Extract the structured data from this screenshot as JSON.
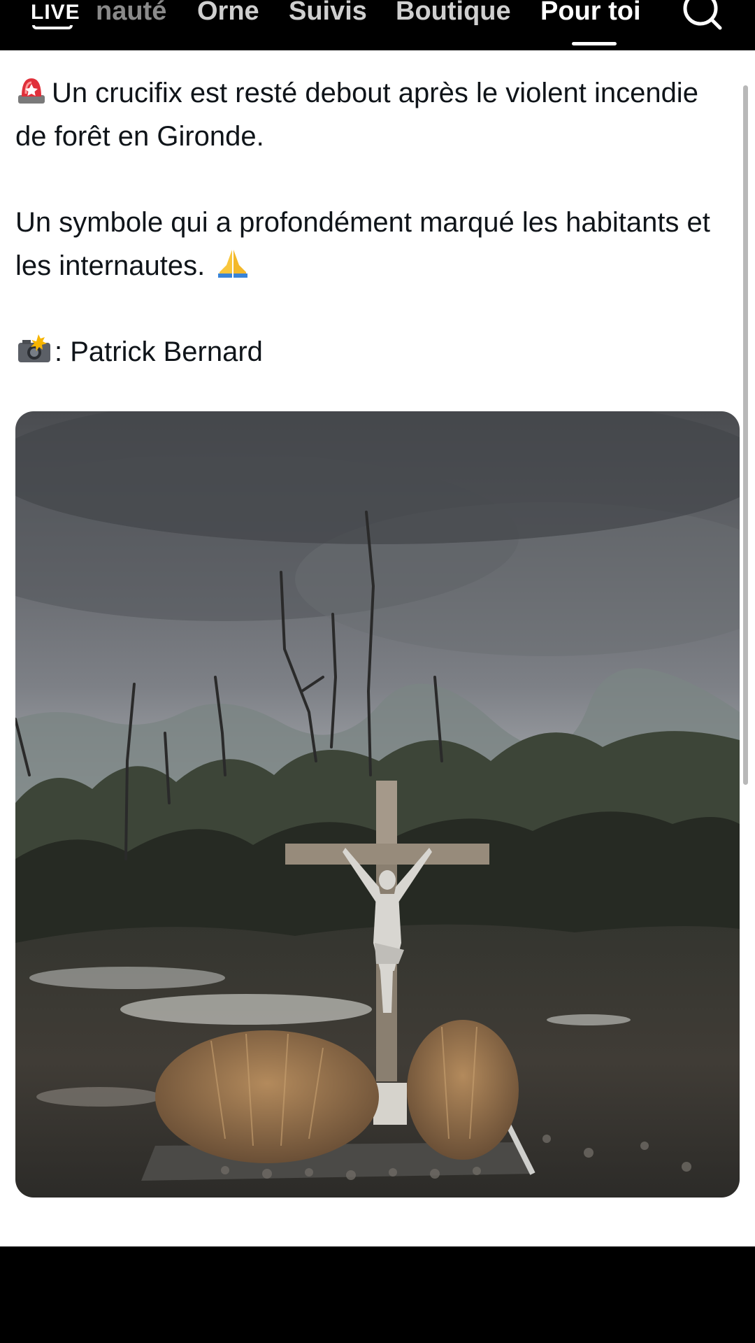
{
  "nav": {
    "live_label": "LIVE",
    "tabs": [
      {
        "label": "nauté",
        "state": "faded"
      },
      {
        "label": "Orne",
        "state": "normal"
      },
      {
        "label": "Suivis",
        "state": "normal"
      },
      {
        "label": "Boutique",
        "state": "normal"
      },
      {
        "label": "Pour toi",
        "state": "active"
      }
    ],
    "search_icon": "search-icon"
  },
  "post": {
    "line1": "Un crucifix est resté debout après le violent incendie de forêt en Gironde.",
    "line2": "Un symbole qui a profondément marqué les habitants et les internautes.",
    "credit": ": Patrick Bernard",
    "icons": {
      "alert": "rotating-light-emoji",
      "pray": "folded-hands-emoji",
      "camera": "camera-flash-emoji"
    }
  },
  "colors": {
    "background": "#ffffff",
    "text": "#0f1419",
    "bar": "#000000"
  }
}
